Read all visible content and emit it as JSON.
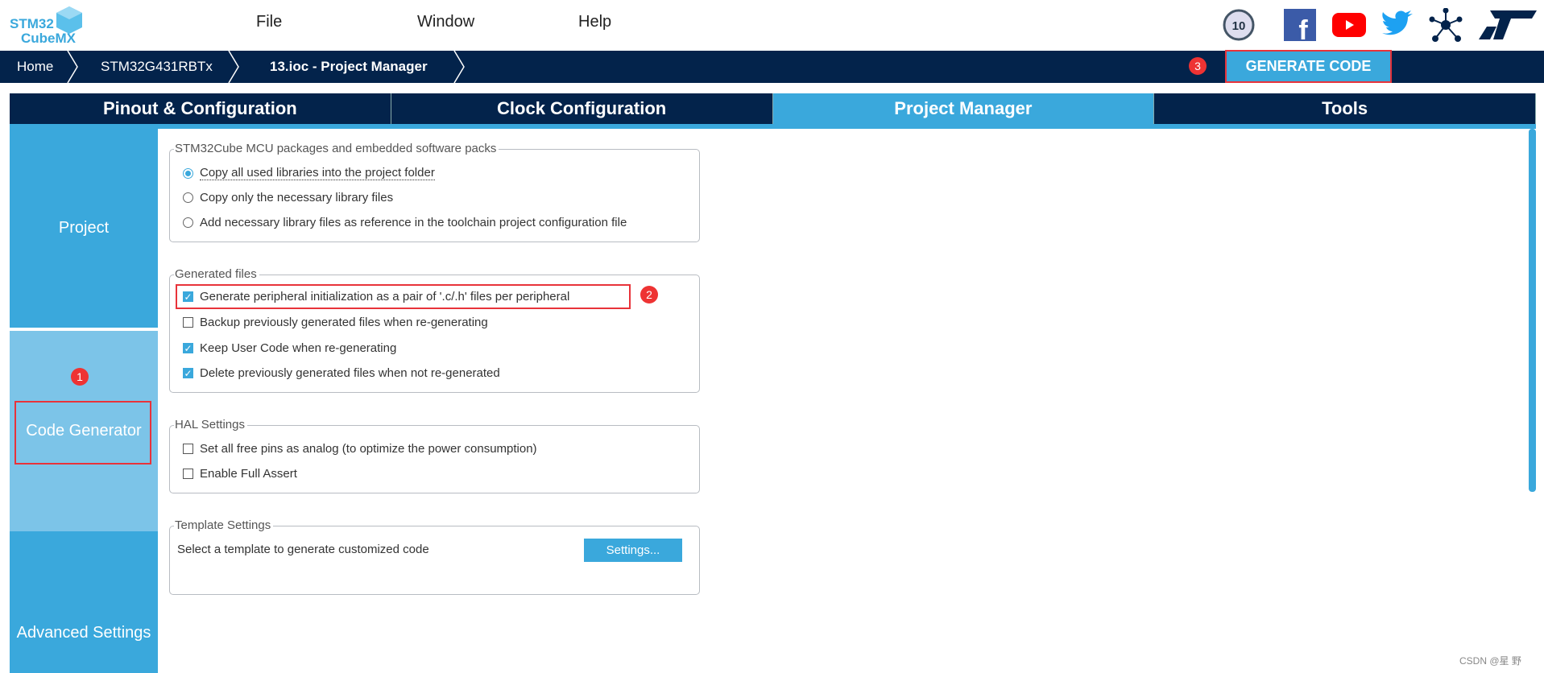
{
  "logo": {
    "line1": "STM32",
    "line2": "CubeMX"
  },
  "menu": [
    "File",
    "Window",
    "Help"
  ],
  "social_icons": [
    "10-years-badge-icon",
    "facebook-icon",
    "youtube-icon",
    "twitter-icon",
    "network-icon",
    "st-logo-icon"
  ],
  "breadcrumb": [
    "Home",
    "STM32G431RBTx",
    "13.ioc - Project Manager"
  ],
  "generate_button": "GENERATE CODE",
  "tabs": [
    {
      "label": "Pinout & Configuration"
    },
    {
      "label": "Clock Configuration"
    },
    {
      "label": "Project Manager",
      "active": true
    },
    {
      "label": "Tools"
    }
  ],
  "sidebar": [
    "Project",
    "Code Generator",
    "Advanced Settings"
  ],
  "groups": {
    "packs": {
      "title": "STM32Cube MCU packages and embedded software packs",
      "options": [
        "Copy all used libraries into the project folder",
        "Copy only the necessary library files",
        "Add necessary library files as reference in the toolchain project configuration file"
      ],
      "selected": 0
    },
    "generated": {
      "title": "Generated files",
      "items": [
        {
          "label": "Generate peripheral initialization as a pair of '.c/.h' files per peripheral",
          "checked": true
        },
        {
          "label": "Backup previously generated files when re-generating",
          "checked": false
        },
        {
          "label": "Keep User Code when re-generating",
          "checked": true
        },
        {
          "label": "Delete previously generated files when not re-generated",
          "checked": true
        }
      ]
    },
    "hal": {
      "title": "HAL Settings",
      "items": [
        {
          "label": "Set all free pins as analog (to optimize the power consumption)",
          "checked": false
        },
        {
          "label": "Enable Full Assert",
          "checked": false
        }
      ]
    },
    "template": {
      "title": "Template Settings",
      "text": "Select a template to generate customized code",
      "button": "Settings..."
    }
  },
  "annotations": [
    "1",
    "2",
    "3"
  ],
  "watermark": "CSDN @星 野",
  "colors": {
    "navy": "#03234b",
    "accent": "#3aa8dc",
    "sidebar_selected": "#7cc4e8",
    "annotation": "#ee3333"
  }
}
